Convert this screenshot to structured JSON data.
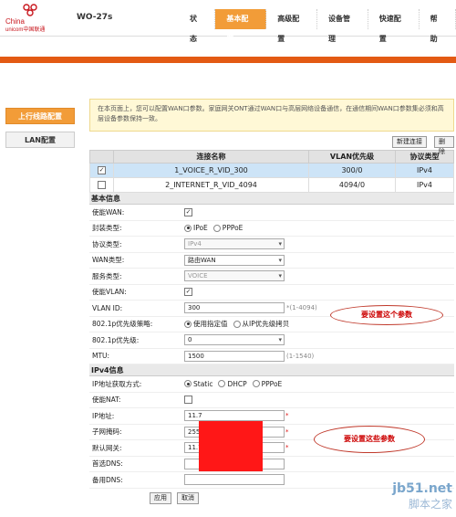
{
  "brand": {
    "line1": "China",
    "line2": "unicom中国联通"
  },
  "model": "WO-27s",
  "nav": [
    "状态",
    "基本配置",
    "高级配置",
    "设备管理",
    "快速配置",
    "帮助"
  ],
  "nav_active": 1,
  "sidebar": [
    "上行线路配置",
    "LAN配置"
  ],
  "notice": "在本页面上，您可以配置WAN口参数。家庭网关ONT通过WAN口与高层网络设备通信，在通信期间WAN口参数集必须和高层设备参数保持一致。",
  "actions": {
    "new": "新建连接",
    "delete": "删除"
  },
  "table": {
    "headers": [
      "",
      "连接名称",
      "VLAN优先级",
      "协议类型"
    ],
    "rows": [
      {
        "checked": true,
        "name": "1_VOICE_R_VID_300",
        "vlan": "300/0",
        "protocol": "IPv4"
      },
      {
        "checked": false,
        "name": "2_INTERNET_R_VID_4094",
        "vlan": "4094/0",
        "protocol": "IPv4"
      }
    ]
  },
  "basic": {
    "title": "基本信息",
    "enable_wan": {
      "label": "使能WAN:"
    },
    "encap": {
      "label": "封装类型:",
      "opt1": "IPoE",
      "opt2": "PPPoE"
    },
    "protocol": {
      "label": "协议类型:",
      "value": "IPv4"
    },
    "wan_type": {
      "label": "WAN类型:",
      "value": "路由WAN"
    },
    "service": {
      "label": "服务类型:",
      "value": "VOICE"
    },
    "enable_vlan": {
      "label": "使能VLAN:"
    },
    "vlan_id": {
      "label": "VLAN ID:",
      "value": "300",
      "hint": "*(1-4094)"
    },
    "policy": {
      "label": "802.1p优先级策略:",
      "opt1": "使用指定值",
      "opt2": "从IP优先级拷贝"
    },
    "priority": {
      "label": "802.1p优先级:",
      "value": "0"
    },
    "mtu": {
      "label": "MTU:",
      "value": "1500",
      "hint": "(1-1540)"
    }
  },
  "ipv4": {
    "title": "IPv4信息",
    "method": {
      "label": "IP地址获取方式:",
      "opt1": "Static",
      "opt2": "DHCP",
      "opt3": "PPPoE"
    },
    "nat": {
      "label": "使能NAT:"
    },
    "ip": {
      "label": "IP地址:",
      "value": "11.7"
    },
    "mask": {
      "label": "子网掩码:",
      "value": "255"
    },
    "gateway": {
      "label": "默认网关:",
      "value": "11.7"
    },
    "dns1": {
      "label": "首选DNS:",
      "value": ""
    },
    "dns2": {
      "label": "备用DNS:",
      "value": ""
    }
  },
  "buttons": {
    "apply": "应用",
    "cancel": "取消"
  },
  "annotations": {
    "a1": "要设置这个参数",
    "a2": "要设置这些参数"
  },
  "watermark": {
    "line1": "jb51.net",
    "line2": "脚本之家"
  },
  "colors": {
    "accent": "#e35a13",
    "tab": "#f29c38",
    "annotation": "#c0392b"
  }
}
